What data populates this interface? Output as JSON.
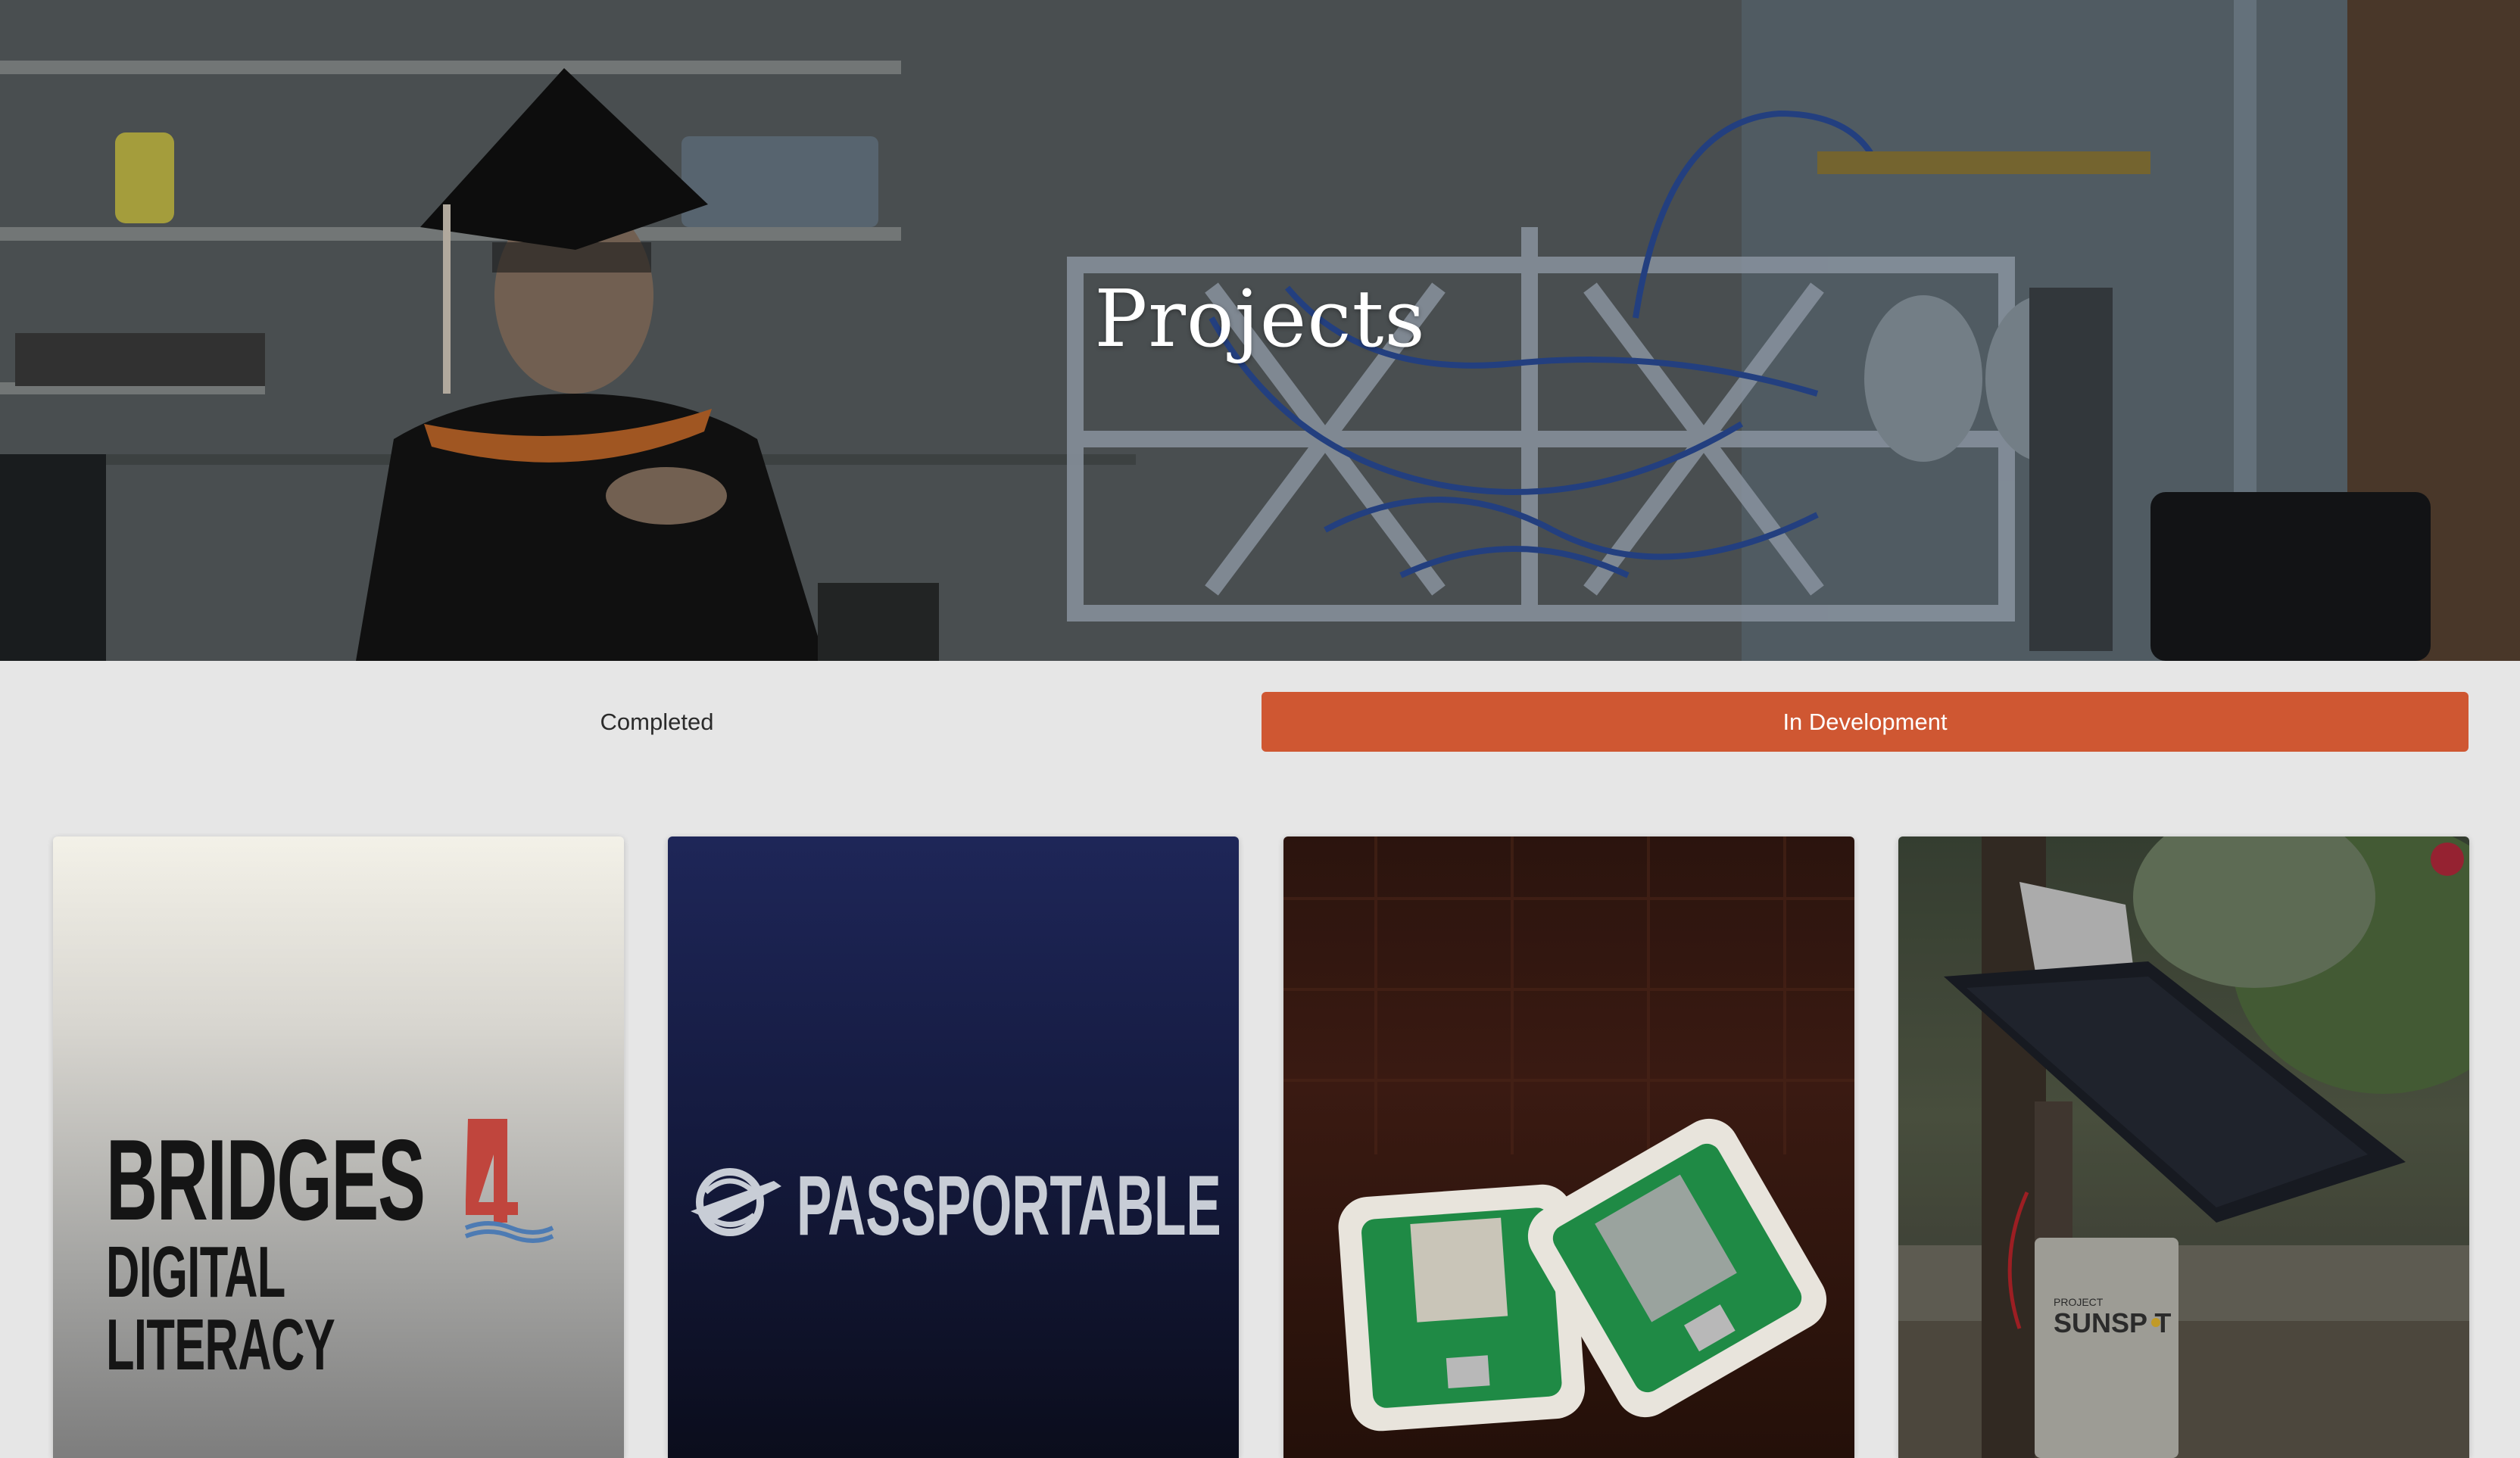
{
  "hero": {
    "title": "Projects"
  },
  "tabs": [
    {
      "label": "Completed",
      "active": false
    },
    {
      "label": "In Development",
      "active": true
    }
  ],
  "accent_color": "#cf5732",
  "cards": [
    {
      "logo_line1": "BRIDGES",
      "logo_line2": "DIGITAL LITERACY",
      "logo_icon": "bridge-4-icon"
    },
    {
      "logo_text": "PASSPORTABLE",
      "logo_icon": "globe-plane-icon"
    },
    {
      "image": "green-circuit-boards-in-white-cases"
    },
    {
      "image": "solar-panel-on-tree",
      "box_label_small": "PROJECT",
      "box_label": "SUNSP  T"
    }
  ]
}
